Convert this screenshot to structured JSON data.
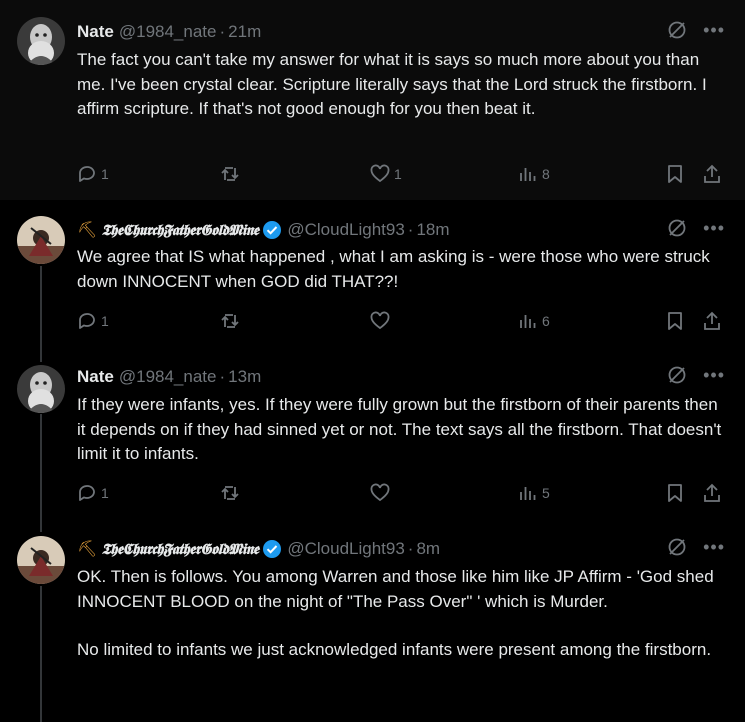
{
  "colors": {
    "background": "#000000",
    "text": "#e7e9ea",
    "muted": "#71767b",
    "verified": "#1d9bf0",
    "thread_line": "#333639"
  },
  "tweets": [
    {
      "name": "Nate",
      "handle": "@1984_nate",
      "separator": "·",
      "time": "21m",
      "verified": false,
      "paragraphs": [
        "The fact you can't take my answer for what it is says so much more about you than me.  I've been crystal clear.  Scripture literally says that the Lord struck the firstborn.  I affirm scripture.  If that's not good enough for you then beat it."
      ],
      "replies": "1",
      "retweets": "",
      "likes": "1",
      "views": "8"
    },
    {
      "name": "𝕿𝖍𝖊𝕮𝖍𝖚𝖗𝖈𝖍𝕱𝖆𝖙𝖍𝖊𝖗𝕲𝖔𝖑𝖉𝕸𝖎𝖓𝖊",
      "name_prefix_icon": "pickaxe-icon",
      "handle": "@CloudLight93",
      "separator": "·",
      "time": "18m",
      "verified": true,
      "paragraphs": [
        "We agree that IS what happened , what I am asking is - were those who were struck down INNOCENT when GOD did THAT??!"
      ],
      "replies": "1",
      "retweets": "",
      "likes": "",
      "views": "6"
    },
    {
      "name": "Nate",
      "handle": "@1984_nate",
      "separator": "·",
      "time": "13m",
      "verified": false,
      "paragraphs": [
        "If they were infants, yes.  If they were fully grown but the firstborn of their parents then it depends on if they had sinned yet or not.  The text says all the firstborn.  That doesn't limit it to infants."
      ],
      "replies": "1",
      "retweets": "",
      "likes": "",
      "views": "5"
    },
    {
      "name": "𝕿𝖍𝖊𝕮𝖍𝖚𝖗𝖈𝖍𝕱𝖆𝖙𝖍𝖊𝖗𝕲𝖔𝖑𝖉𝕸𝖎𝖓𝖊",
      "name_prefix_icon": "pickaxe-icon",
      "handle": "@CloudLight93",
      "separator": "·",
      "time": "8m",
      "verified": true,
      "paragraphs": [
        "OK. Then is follows. You among Warren and those like him like JP Affirm - 'God shed INNOCENT BLOOD on the night of \"The Pass Over\" ' which is Murder.",
        "No limited to infants we just acknowledged infants were present among the firstborn."
      ]
    }
  ]
}
